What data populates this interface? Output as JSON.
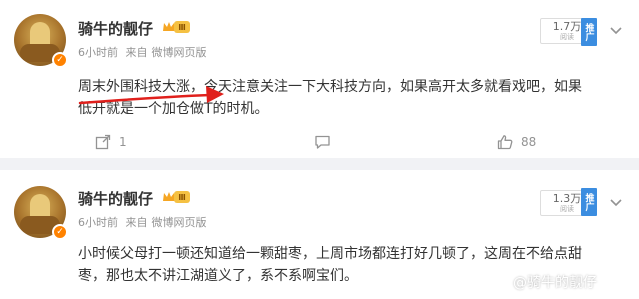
{
  "posts": [
    {
      "author": "骑牛的靓仔",
      "level": "Ⅲ",
      "time": "6小时前",
      "source_prefix": "来自",
      "source": "微博网页版",
      "reads_count": "1.7万",
      "reads_label": "阅读",
      "promote_label": "推广",
      "content_line1": "周末外围科技大涨，今天注意关注一下大科技方向，如果高开太多就看戏吧，如果",
      "content_line2": "低开就是一个加仓做T的时机。",
      "repost_count": "1",
      "comment_count": "",
      "like_count": "88"
    },
    {
      "author": "骑牛的靓仔",
      "level": "Ⅲ",
      "time": "6小时前",
      "source_prefix": "来自",
      "source": "微博网页版",
      "reads_count": "1.3万",
      "reads_label": "阅读",
      "promote_label": "推广",
      "content_line1": "小时候父母打一顿还知道给一颗甜枣，上周市场都连打好几顿了，这周在不给点甜",
      "content_line2": "枣，那也太不讲江湖道义了，系不系啊宝们。"
    }
  ],
  "watermark": "@骑牛的靓仔",
  "colors": {
    "accent_orange": "#ff8200",
    "annotation_red": "#e0201c",
    "promote_blue": "#3b8de0",
    "meta_gray": "#939393"
  },
  "icons": [
    "repost-icon",
    "comment-icon",
    "like-icon",
    "chevron-down-icon",
    "crown-icon"
  ]
}
